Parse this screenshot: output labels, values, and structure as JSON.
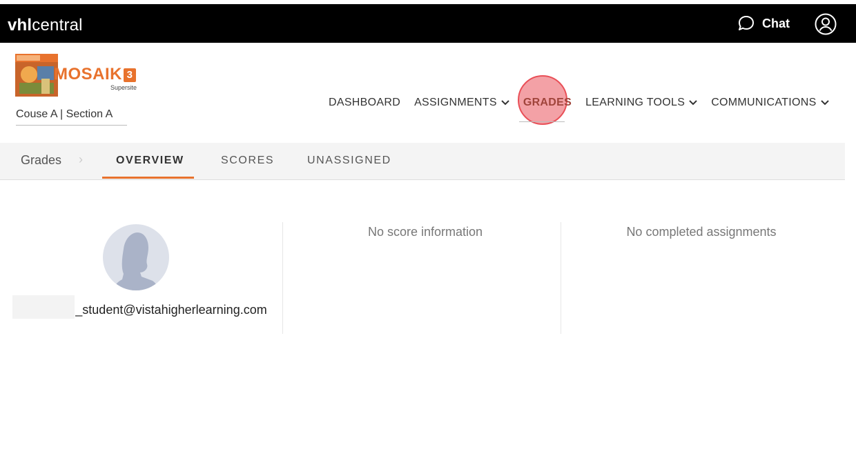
{
  "topbar": {
    "brand_bold": "vhl",
    "brand_rest": "central",
    "chat_label": "Chat",
    "chat_icon": "chat-bubble-icon",
    "user_icon": "user-circle-icon"
  },
  "header": {
    "logo_word": "MOSAIK",
    "logo_number": "3",
    "logo_sub": "Supersite",
    "course_select": "Couse A | Section A"
  },
  "nav": {
    "items": [
      {
        "label": "DASHBOARD",
        "dropdown": false
      },
      {
        "label": "ASSIGNMENTS",
        "dropdown": true
      },
      {
        "label": "GRADES",
        "dropdown": false,
        "active": true
      },
      {
        "label": "LEARNING TOOLS",
        "dropdown": true
      },
      {
        "label": "COMMUNICATIONS",
        "dropdown": true
      }
    ]
  },
  "subnav": {
    "breadcrumb": "Grades",
    "tabs": [
      "OVERVIEW",
      "SCORES",
      "UNASSIGNED"
    ],
    "active_tab": "OVERVIEW"
  },
  "content": {
    "email": "_student@vistahigherlearning.com",
    "no_score": "No score information",
    "no_assignments": "No completed assignments"
  },
  "colors": {
    "accent": "#e8722d",
    "topbar": "#000000",
    "active_nav": "#a0443b"
  }
}
